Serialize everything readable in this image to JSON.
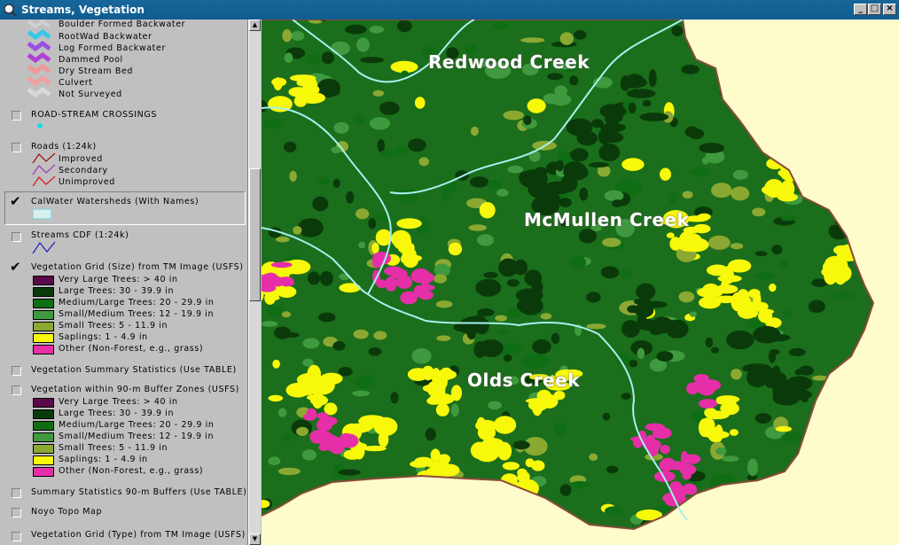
{
  "window": {
    "title": "Streams, Vegetation"
  },
  "legend": {
    "stream_features": [
      "Boulder Formed Backwater",
      "RootWad Backwater",
      "Log Formed Backwater",
      "Dammed Pool",
      "Dry Stream Bed",
      "Culvert",
      "Not Surveyed"
    ],
    "road_stream": {
      "label": "ROAD-STREAM CROSSINGS",
      "checked": false
    },
    "roads": {
      "label": "Roads (1:24k)",
      "checked": false,
      "items": [
        "Improved",
        "Secondary",
        "Unimproved"
      ]
    },
    "calwater": {
      "label": "CalWater Watersheds (With Names)",
      "checked": true
    },
    "streams_cdf": {
      "label": "Streams CDF (1:24k)",
      "checked": false
    },
    "veg_grid_size": {
      "label": "Vegetation Grid (Size) from TM Image (USFS)",
      "checked": true,
      "items": [
        {
          "label": "Very Large Trees: > 40  in",
          "color": "#5a0a4a"
        },
        {
          "label": "Large Trees: 30 - 39.9 in",
          "color": "#0a3a0a"
        },
        {
          "label": "Medium/Large Trees: 20 - 29.9 in",
          "color": "#0f6d14"
        },
        {
          "label": "Small/Medium Trees: 12 - 19.9 in",
          "color": "#3f9a3f"
        },
        {
          "label": "Small Trees: 5 - 11.9 in",
          "color": "#8aa832"
        },
        {
          "label": "Saplings: 1 - 4.9 in",
          "color": "#f8f80a"
        },
        {
          "label": "Other (Non-Forest, e.g., grass)",
          "color": "#e62ea8"
        }
      ]
    },
    "veg_summary": {
      "label": "Vegetation Summary Statistics (Use TABLE)",
      "checked": false
    },
    "veg_buffer": {
      "label": "Vegetation within 90-m Buffer Zones (USFS)",
      "checked": false,
      "items": [
        {
          "label": "Very Large Trees: > 40  in",
          "color": "#5a0a4a"
        },
        {
          "label": "Large Trees: 30 - 39.9 in",
          "color": "#0a3a0a"
        },
        {
          "label": "Medium/Large Trees: 20 - 29.9 in",
          "color": "#0f6d14"
        },
        {
          "label": "Small/Medium Trees: 12 - 19.9 in",
          "color": "#3f9a3f"
        },
        {
          "label": "Small Trees: 5 - 11.9 in",
          "color": "#8aa832"
        },
        {
          "label": "Saplings: 1 - 4.9 in",
          "color": "#f8f80a"
        },
        {
          "label": "Other (Non-Forest, e.g., grass)",
          "color": "#e62ea8"
        }
      ]
    },
    "summary_buffers": {
      "label": "Summary Statistics 90-m Buffers (Use TABLE)",
      "checked": false
    },
    "noyo_topo": {
      "label": "Noyo Topo Map",
      "checked": false
    },
    "veg_grid_type": {
      "label": "Vegetation Grid (Type) from TM Image (USFS)",
      "checked": false
    }
  },
  "map": {
    "labels": {
      "redwood": "Redwood Creek",
      "mcmullen": "McMullen Creek",
      "olds": "Olds Creek"
    },
    "colors": {
      "background": "#fffccc",
      "boundary": "#8a4a3a",
      "watershed_line": "#a8f0f0"
    }
  }
}
